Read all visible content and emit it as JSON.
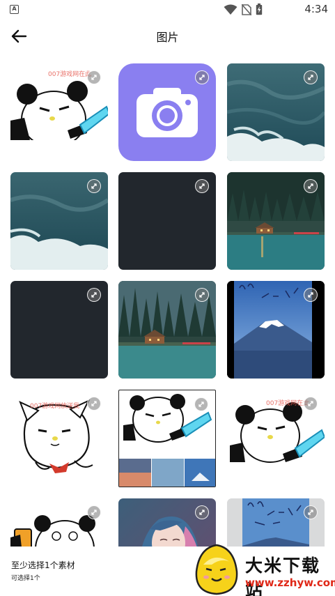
{
  "status_bar": {
    "time": "4:34",
    "app_badge": "A"
  },
  "header": {
    "title": "图片"
  },
  "tiles": [
    {
      "kind": "panda-sword",
      "watermark": "007游戏网在此"
    },
    {
      "kind": "camera-app",
      "watermark": ""
    },
    {
      "kind": "ocean-waves",
      "watermark": ""
    },
    {
      "kind": "ocean-waves",
      "watermark": ""
    },
    {
      "kind": "blank-dark",
      "watermark": ""
    },
    {
      "kind": "lake-cabin",
      "watermark": ""
    },
    {
      "kind": "blank-dark",
      "watermark": ""
    },
    {
      "kind": "lake-cabin",
      "watermark": ""
    },
    {
      "kind": "mount-fuji",
      "watermark": ""
    },
    {
      "kind": "cat-face",
      "watermark": "007游戏网放送我"
    },
    {
      "kind": "panda-collage",
      "watermark": ""
    },
    {
      "kind": "panda-sword",
      "watermark": "007游戏网在此"
    },
    {
      "kind": "panda-small",
      "watermark": ""
    },
    {
      "kind": "girl-portrait",
      "watermark": ""
    },
    {
      "kind": "fuji-sketch",
      "watermark": ""
    }
  ],
  "bottom": {
    "hint": "至少选择1个素材",
    "sub": "可选择1个"
  },
  "logo": {
    "name": "大米下载站",
    "url": "www.zzhyw.com"
  },
  "colors": {
    "camera_bg": "#8a7ff0",
    "dark_tile": "#22272d",
    "logo_url": "#e02818"
  },
  "icons": {
    "back": "arrow-left-icon",
    "expand": "expand-arrows-icon"
  }
}
